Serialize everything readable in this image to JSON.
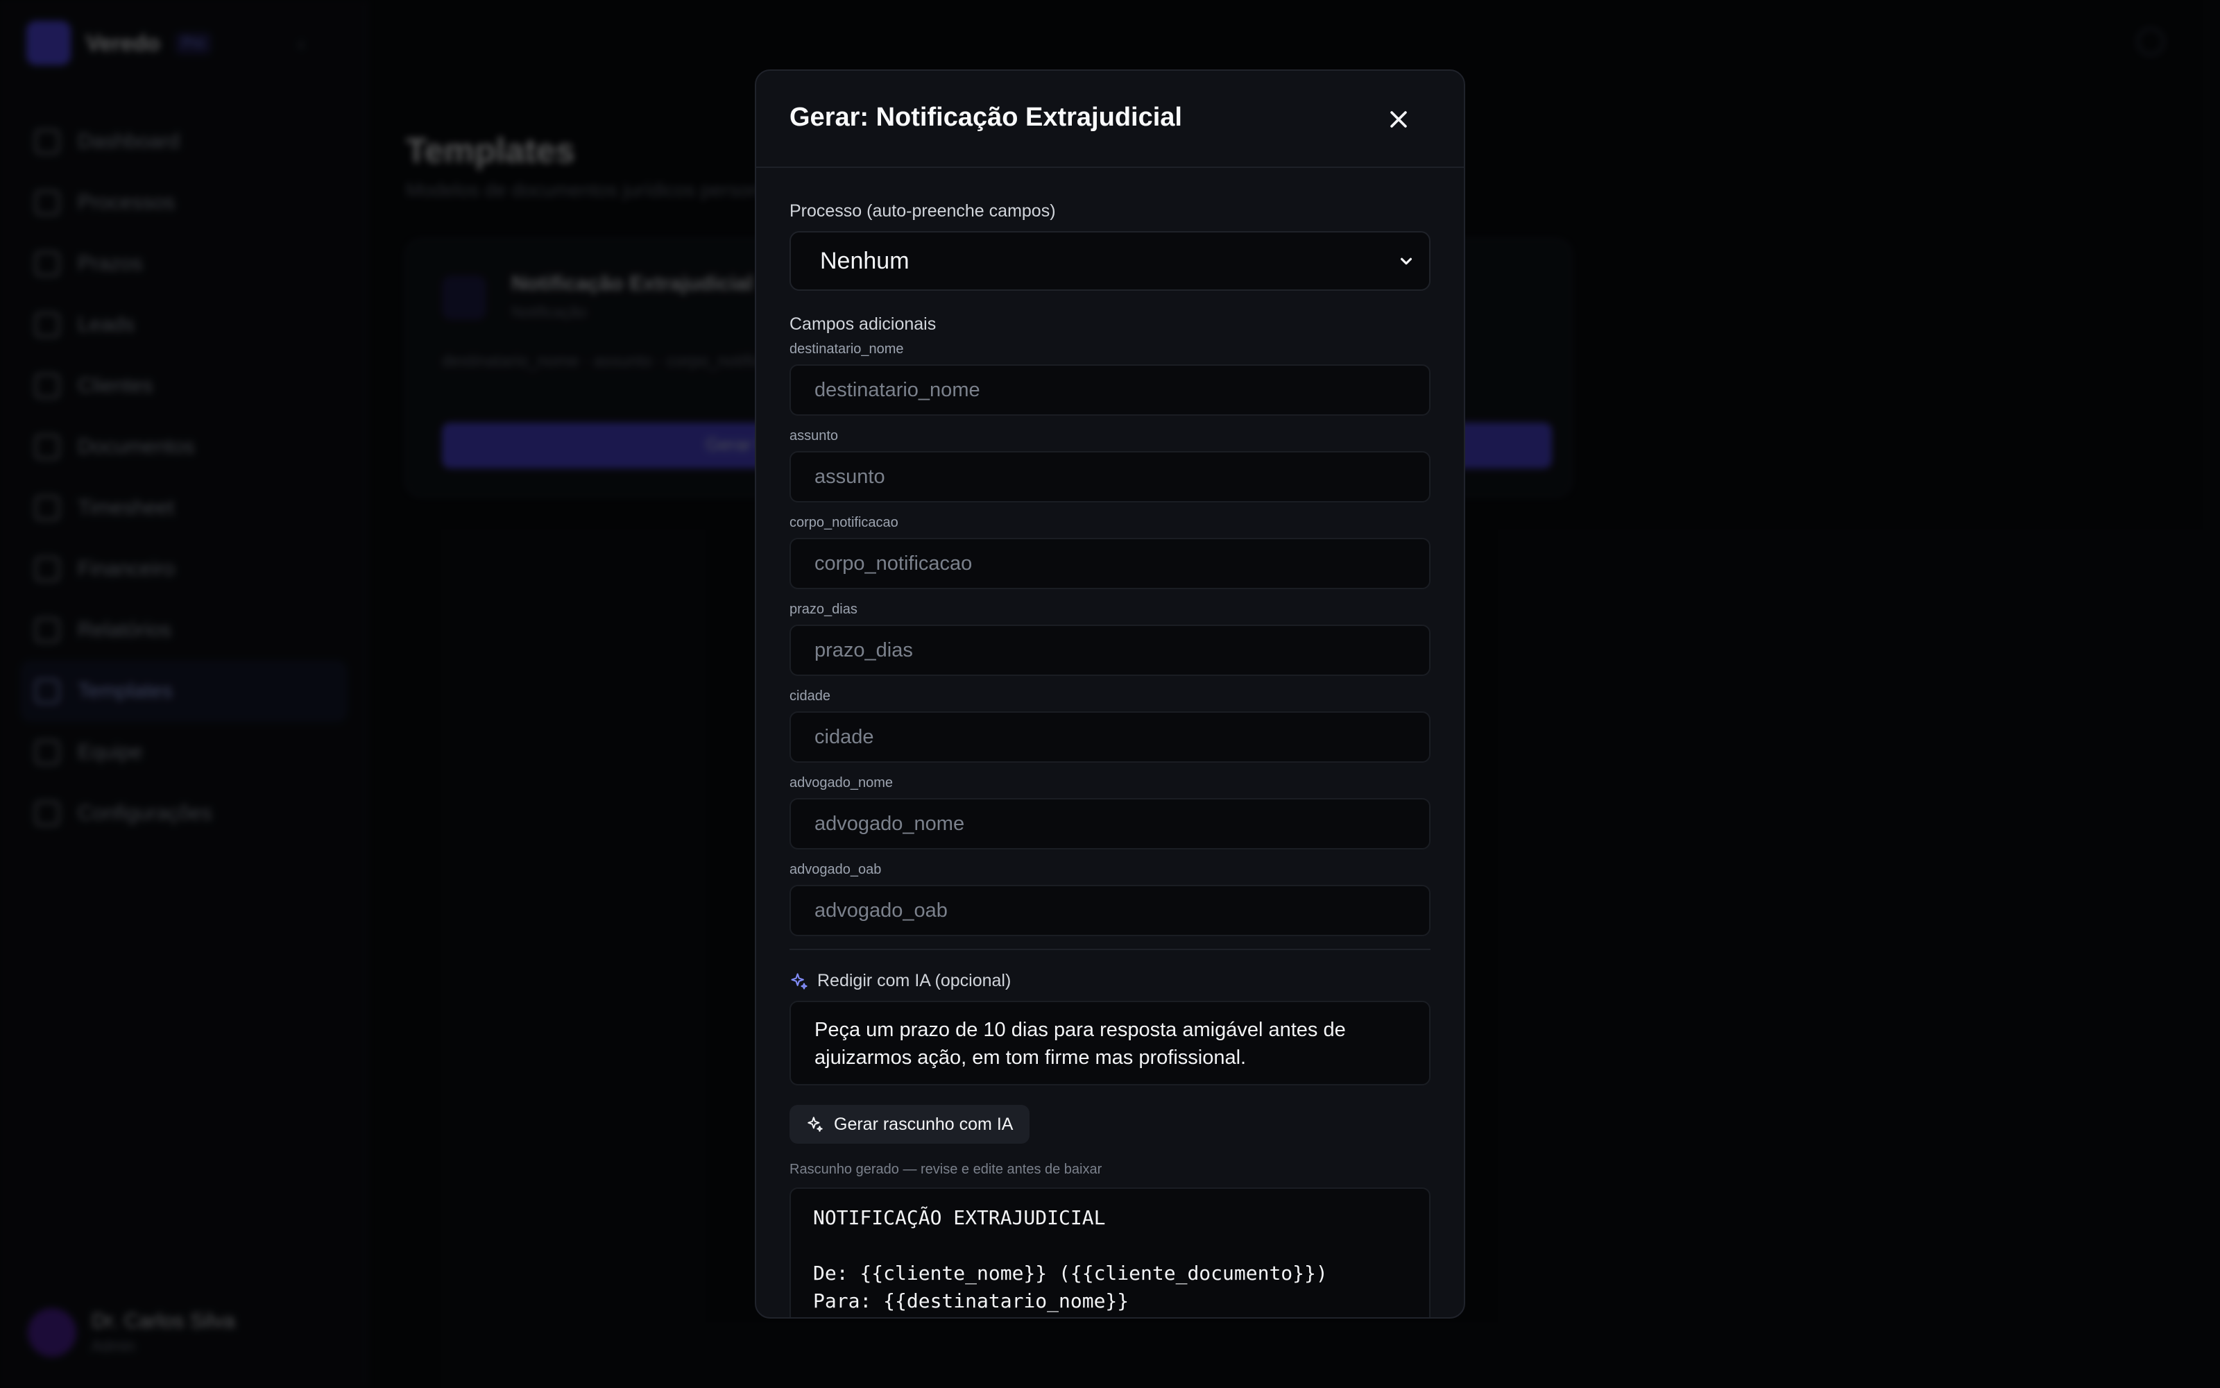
{
  "sidebar": {
    "brand": "Veredo",
    "brand_badge": "Pro",
    "items": [
      {
        "label": "Dashboard"
      },
      {
        "label": "Processos"
      },
      {
        "label": "Prazos"
      },
      {
        "label": "Leads"
      },
      {
        "label": "Clientes"
      },
      {
        "label": "Documentos"
      },
      {
        "label": "Timesheet"
      },
      {
        "label": "Financeiro"
      },
      {
        "label": "Relatórios"
      },
      {
        "label": "Templates"
      },
      {
        "label": "Equipe"
      },
      {
        "label": "Configurações"
      }
    ],
    "user": {
      "name": "Dr. Carlos Silva",
      "role": "Admin"
    }
  },
  "main": {
    "title": "Templates",
    "subtitle": "Modelos de documentos jurídicos personalizáveis",
    "card": {
      "title": "Notificação Extrajudicial",
      "subtitle": "Notificação",
      "tags": "destinatario_nome · assunto · corpo_notificacao · prazo_dias · cidade · advogado_nome · advogado_oab · ...",
      "button": "Gerar PDF"
    }
  },
  "modal": {
    "title": "Gerar: Notificação Extrajudicial",
    "process_label": "Processo (auto-preenche campos)",
    "process_selected": "Nenhum",
    "fields_section": "Campos adicionais",
    "fields": [
      {
        "label": "destinatario_nome",
        "placeholder": "destinatario_nome"
      },
      {
        "label": "assunto",
        "placeholder": "assunto"
      },
      {
        "label": "corpo_notificacao",
        "placeholder": "corpo_notificacao"
      },
      {
        "label": "prazo_dias",
        "placeholder": "prazo_dias"
      },
      {
        "label": "cidade",
        "placeholder": "cidade"
      },
      {
        "label": "advogado_nome",
        "placeholder": "advogado_nome"
      },
      {
        "label": "advogado_oab",
        "placeholder": "advogado_oab"
      }
    ],
    "ai_label": "Redigir com IA (opcional)",
    "ai_prompt": "Peça um prazo de 10 dias para resposta amigável antes de ajuizarmos ação, em tom firme mas profissional.",
    "generate_button": "Gerar rascunho com IA",
    "draft_label": "Rascunho gerado — revise e edite antes de baixar",
    "draft_text": "NOTIFICAÇÃO EXTRAJUDICIAL\n\nDe: {{cliente_nome}} ({{cliente_documento}})\nPara: {{destinatario_nome}}"
  },
  "colors": {
    "accent": "#4f46e5",
    "sparkle": "#818cf8",
    "modal_bg": "#0f1116",
    "input_bg": "#08090c"
  }
}
